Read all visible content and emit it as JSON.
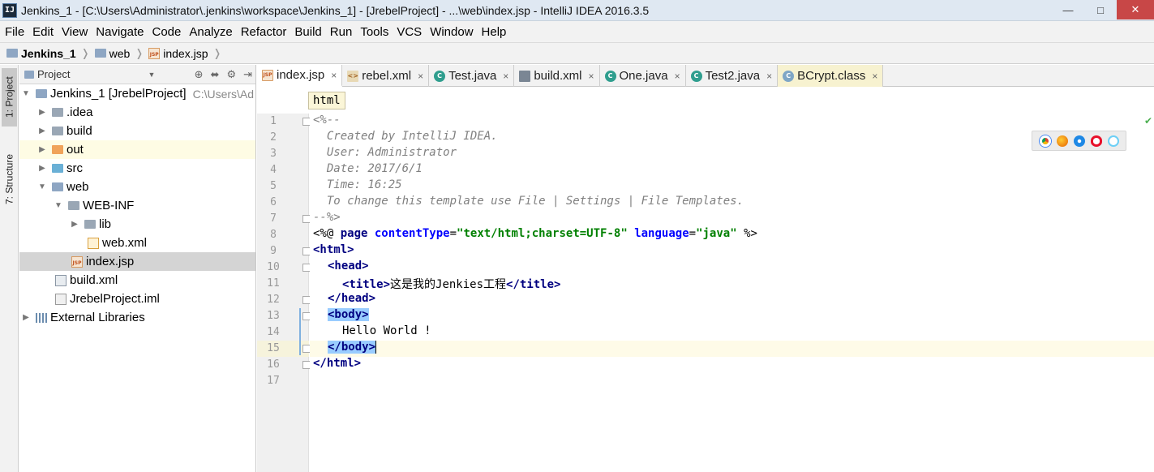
{
  "window": {
    "app_icon": "IJ",
    "title": "Jenkins_1 - [C:\\Users\\Administrator\\.jenkins\\workspace\\Jenkins_1] - [JrebelProject] - ...\\web\\index.jsp - IntelliJ IDEA 2016.3.5"
  },
  "menu": [
    {
      "label": "File"
    },
    {
      "label": "Edit"
    },
    {
      "label": "View"
    },
    {
      "label": "Navigate"
    },
    {
      "label": "Code"
    },
    {
      "label": "Analyze"
    },
    {
      "label": "Refactor"
    },
    {
      "label": "Build"
    },
    {
      "label": "Run"
    },
    {
      "label": "Tools"
    },
    {
      "label": "VCS"
    },
    {
      "label": "Window"
    },
    {
      "label": "Help"
    }
  ],
  "navbar": {
    "crumbs": [
      "Jenkins_1",
      "web",
      "index.jsp"
    ]
  },
  "left_strip": {
    "project_tab": "1: Project",
    "structure_tab": "7: Structure"
  },
  "project_panel": {
    "header": "Project",
    "tree": [
      {
        "label": "Jenkins_1 [JrebelProject]",
        "hint": "C:\\Users\\Ad",
        "icon": "module-folder-icon"
      },
      {
        "label": ".idea",
        "icon": "folder-icon"
      },
      {
        "label": "build",
        "icon": "folder-icon"
      },
      {
        "label": "out",
        "icon": "excluded-folder-icon"
      },
      {
        "label": "src",
        "icon": "source-folder-icon"
      },
      {
        "label": "web",
        "icon": "web-folder-icon"
      },
      {
        "label": "WEB-INF",
        "icon": "folder-icon"
      },
      {
        "label": "lib",
        "icon": "folder-icon"
      },
      {
        "label": "web.xml",
        "icon": "xml-file-icon"
      },
      {
        "label": "index.jsp",
        "icon": "jsp-file-icon"
      },
      {
        "label": "build.xml",
        "icon": "ant-file-icon"
      },
      {
        "label": "JrebelProject.iml",
        "icon": "iml-file-icon"
      },
      {
        "label": "External Libraries",
        "icon": "libraries-icon"
      }
    ]
  },
  "tabs": [
    {
      "label": "index.jsp",
      "icon": "jsp"
    },
    {
      "label": "rebel.xml",
      "icon": "xml"
    },
    {
      "label": "Test.java",
      "icon": "java"
    },
    {
      "label": "build.xml",
      "icon": "bxml"
    },
    {
      "label": "One.java",
      "icon": "java"
    },
    {
      "label": "Test2.java",
      "icon": "java"
    },
    {
      "label": "BCrypt.class",
      "icon": "cls"
    }
  ],
  "tab_close_glyph": "×",
  "editor": {
    "crumb": "html",
    "line_numbers": [
      "1",
      "2",
      "3",
      "4",
      "5",
      "6",
      "7",
      "8",
      "9",
      "10",
      "11",
      "12",
      "13",
      "14",
      "15",
      "16",
      "17"
    ],
    "lines": {
      "l1": "<%--",
      "l2": "  Created by IntelliJ IDEA.",
      "l3": "  User: Administrator",
      "l4": "  Date: 2017/6/1",
      "l5": "  Time: 16:25",
      "l6": "  To change this template use File | Settings | File Templates.",
      "l7": "--%>",
      "l8": {
        "open": "<%@ ",
        "kw": "page",
        "a1": "contentType",
        "v1": "\"text/html;charset=UTF-8\"",
        "a2": "language",
        "v2": "\"java\"",
        "close": " %>"
      },
      "l9": "<html>",
      "l10": "<head>",
      "l11": {
        "open": "<title>",
        "text": "这是我的Jenkies工程",
        "close": "</title>"
      },
      "l12": "</head>",
      "l13": "<body>",
      "l14": "Hello World !",
      "l15": "</body>",
      "l16": "</html>"
    }
  },
  "colors": {
    "comment": "#808080",
    "tag": "#000080",
    "attribute": "#0000ff",
    "string": "#008000",
    "brace_match": "#99ccff"
  },
  "browser_icons": [
    "chrome-icon",
    "firefox-icon",
    "safari-icon",
    "opera-icon",
    "ie-icon"
  ]
}
